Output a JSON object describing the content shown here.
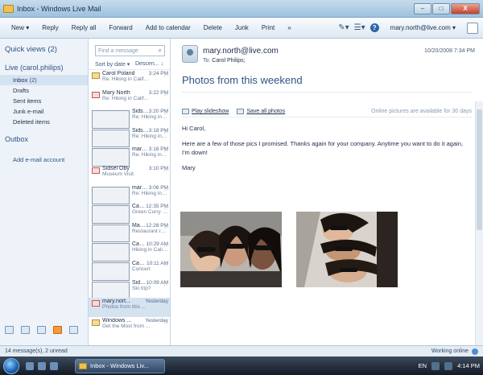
{
  "window": {
    "title": "Inbox - Windows Live Mail",
    "controls": [
      "–",
      "□",
      "X"
    ]
  },
  "toolbar": {
    "items": [
      "New ▾",
      "Reply",
      "Reply all",
      "Forward",
      "Add to calendar",
      "Delete",
      "Junk",
      "Print",
      "»"
    ],
    "account": "mary.north@live.com ▾",
    "help": "?"
  },
  "folders": {
    "quick_views": "Quick views  (2)",
    "account": "Live (carol.philips)",
    "items": [
      {
        "label": "Inbox",
        "count": "(2)"
      },
      {
        "label": "Drafts",
        "count": ""
      },
      {
        "label": "Sent items",
        "count": ""
      },
      {
        "label": "Junk e-mail",
        "count": ""
      },
      {
        "label": "Deleted items",
        "count": ""
      }
    ],
    "outbox": "Outbox",
    "add_account": "Add e-mail account"
  },
  "list": {
    "find_placeholder": "Find a message",
    "sort_label": "Sort by date ▾",
    "sort_order": "Descen... ↓",
    "messages": [
      {
        "sender": "Carol Poland",
        "time": "3:24 PM",
        "subject": "Re: Hiking in Calif...",
        "icon": "envelope",
        "flag": "⚐"
      },
      {
        "sender": "Mary North",
        "time": "3:22 PM",
        "subject": "Re: Hiking in Calif...",
        "icon": "reply",
        "flag": "⚐"
      },
      {
        "sender": "Sidsel Oby",
        "time": "3:20 PM",
        "subject": "Re: Hiking in Calif...",
        "icon": "read",
        "flag": "⚐"
      },
      {
        "sender": "Sidsel Oby",
        "time": "3:18 PM",
        "subject": "Re: Hiking in Calif...",
        "icon": "read",
        "flag": "⚐"
      },
      {
        "sender": "mary.north...",
        "time": "3:16 PM",
        "subject": "Re: Hiking in Calif...",
        "icon": "read",
        "flag": "⚐"
      },
      {
        "sender": "Sidsel Oby",
        "time": "3:10 PM",
        "subject": "Museum Visit",
        "icon": "reply",
        "flag": "⚐"
      },
      {
        "sender": "mary.north...",
        "time": "3:06 PM",
        "subject": "Re: Hiking in Calif...",
        "icon": "read",
        "flag": "⚐"
      },
      {
        "sender": "Carol Phili...",
        "time": "12:35 PM",
        "subject": "Green Curry Recipe",
        "icon": "read",
        "flag": "⚐"
      },
      {
        "sender": "Mary North",
        "time": "12:28 PM",
        "subject": "Restaurant recomm...",
        "icon": "read",
        "flag": "⚐"
      },
      {
        "sender": "Carole Pol...",
        "time": "10:29 AM",
        "subject": "Hiking in California",
        "icon": "read",
        "flag": "⚐"
      },
      {
        "sender": "Carole Pol...",
        "time": "10:11 AM",
        "subject": "Concert",
        "icon": "read",
        "flag": "⚐"
      },
      {
        "sender": "Sidsel Oby",
        "time": "10:09 AM",
        "subject": "Ski trip?",
        "icon": "read",
        "flag": "⚐"
      },
      {
        "sender": "mary.nort...",
        "time": "Yesterday",
        "subject": "Photos from this ...",
        "icon": "reply",
        "flag": "⚐",
        "selected": true
      },
      {
        "sender": "Windows ...",
        "time": "Yesterday",
        "subject": "Get the Most from ...",
        "icon": "envelope",
        "flag": "⚐"
      }
    ]
  },
  "reading": {
    "from": "mary.north@live.com",
    "to_label": "To:",
    "to_value": "Carol Philips;",
    "date": "10/20/2008 7:34 PM",
    "subject": "Photos from this weekend",
    "play_slideshow": "Play slideshow",
    "save_all": "Save all photos",
    "photo_note": "Online pictures are available for 30 days",
    "greeting": "Hi Carol,",
    "body": "Here are a few of those pics I promised. Thanks again for your company. Anytime you want to do it again, I'm down!",
    "signature": "Mary"
  },
  "status": {
    "left": "14 message(s), 2 unread",
    "right": "Working online"
  },
  "taskbar": {
    "task": "Inbox - Windows Liv...",
    "lang": "EN",
    "clock": "4:14 PM"
  }
}
